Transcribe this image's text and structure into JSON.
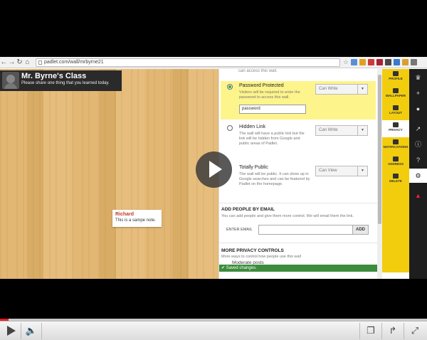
{
  "browser": {
    "url": "padlet.com/wall/mrbyrne21"
  },
  "wall": {
    "title": "Mr. Byrne's Class",
    "subtitle": "Please share one thing that you learned today.",
    "note": {
      "author": "Richard",
      "text": "This is a sampe note."
    }
  },
  "privacy": {
    "top_text": "can access this wall.",
    "options": [
      {
        "title": "Password Protected",
        "desc": "Visitors will be required to enter the password to access this wall.",
        "permission": "Can Write",
        "password": "password",
        "selected": true
      },
      {
        "title": "Hidden Link",
        "desc": "The wall will have a public link but the link will be hidden from Google and public areas of Padlet.",
        "permission": "Can Write",
        "selected": false
      },
      {
        "title": "Totally Public",
        "desc": "The wall will be public. It can show up in Google searches and can be featured by Padlet on the homepage.",
        "permission": "Can View",
        "selected": false
      }
    ],
    "add_people": {
      "heading": "ADD PEOPLE BY EMAIL",
      "desc": "You can add people and give them more control. We will email them the link.",
      "label": "ENTER EMAIL",
      "button": "ADD"
    },
    "more": {
      "heading": "MORE PRIVACY CONTROLS",
      "desc": "More ways to control how people use this wall",
      "sub_option": "Moderate posts"
    },
    "saved": "Saved changes."
  },
  "tabs": [
    {
      "label": "PROFILE",
      "icon": "profile-icon"
    },
    {
      "label": "WALLPAPER",
      "icon": "wallpaper-icon"
    },
    {
      "label": "LAYOUT",
      "icon": "layout-icon"
    },
    {
      "label": "PRIVACY",
      "icon": "lock-icon",
      "active": true
    },
    {
      "label": "NOTIFICATIONS",
      "icon": "envelope-icon"
    },
    {
      "label": "ADDRESS",
      "icon": "link-icon"
    },
    {
      "label": "DELETE",
      "icon": "trash-icon"
    }
  ],
  "player": {
    "progress": 0.02
  },
  "colors": {
    "tab_yellow": "#f2cd0e",
    "selected_yellow": "#fdf48c",
    "saved_green": "#3c8c3c",
    "progress_red": "#dd2222"
  }
}
